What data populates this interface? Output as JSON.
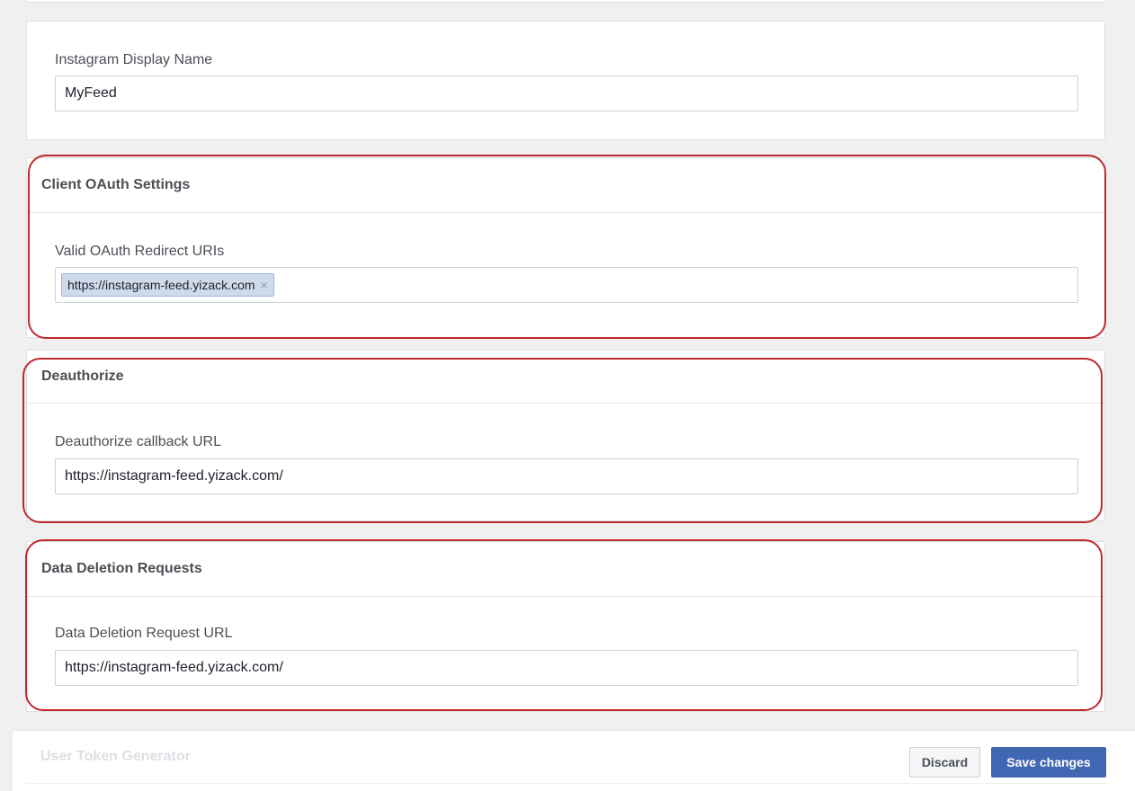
{
  "display_name_section": {
    "label": "Instagram Display Name",
    "value": "MyFeed"
  },
  "oauth_section": {
    "title": "Client OAuth Settings",
    "field_label": "Valid OAuth Redirect URIs",
    "tags": [
      {
        "text": "https://instagram-feed.yizack.com",
        "remove_icon": "×"
      }
    ]
  },
  "deauthorize_section": {
    "title": "Deauthorize",
    "field_label": "Deauthorize callback URL",
    "value": "https://instagram-feed.yizack.com/"
  },
  "data_deletion_section": {
    "title": "Data Deletion Requests",
    "field_label": "Data Deletion Request URL",
    "value": "https://instagram-feed.yizack.com/"
  },
  "footer": {
    "faded_section_title": "User Token Generator",
    "discard_label": "Discard",
    "save_label": "Save changes"
  },
  "colors": {
    "annotation_red": "#c0282f",
    "primary_button": "#4267b2",
    "tag_background": "#cfdaeb"
  }
}
